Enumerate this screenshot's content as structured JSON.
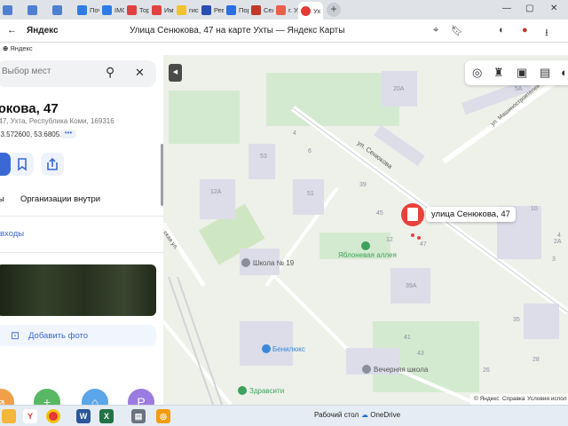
{
  "browser": {
    "tabs": [
      {
        "label": "",
        "color": "#4f7fd1"
      },
      {
        "label": "",
        "color": "#4f7fd1"
      },
      {
        "label": "",
        "color": "#4f7fd1"
      },
      {
        "label": "Поч",
        "color": "#2e7be6"
      },
      {
        "label": "IMC",
        "color": "#2e7be6"
      },
      {
        "label": "Тор",
        "color": "#e24141"
      },
      {
        "label": "Иму",
        "color": "#e24141"
      },
      {
        "label": "гис",
        "color": "#f2c230"
      },
      {
        "label": "Рев",
        "color": "#2a4db0"
      },
      {
        "label": "Пор",
        "color": "#2a6fe0"
      },
      {
        "label": "Сел",
        "color": "#c0392b"
      },
      {
        "label": "г. Ух",
        "color": "#e8604c"
      },
      {
        "label": "Ух",
        "color": "#e53935"
      }
    ],
    "new_tab": "+",
    "brand": "Яндекс",
    "page_title": "Улица Сенюкова, 47 на карте Ухты — Яндекс Карты",
    "bookmark": "Яндекс"
  },
  "panel": {
    "search_placeholder": "Выбор мест",
    "address_title": "юкова, 47",
    "address_sub": ", 47, Ухта, Республика Коми, 169316",
    "coordinates": "63.572600, 53.680510",
    "coords_more": "•••",
    "tab_1": "ы",
    "tab_2": "Организации внутри",
    "link": "входы",
    "add_photo": "Добавить фото"
  },
  "map": {
    "streets": {
      "senyukova": "ул. Сенюкова",
      "mashinostroiteley": "ул. Машиностроителей",
      "side": "ская ул."
    },
    "places": {
      "school19": "Школа № 19",
      "yablonevaya": "Яблоневая аллея",
      "benilux": "Бенилюкс",
      "evening_school": "Вечерняя школа",
      "zdravsiti": "Здравсити"
    },
    "building_numbers": [
      "20А",
      "53",
      "12А",
      "51",
      "45",
      "39",
      "12",
      "47",
      "39А",
      "35",
      "43",
      "26",
      "28",
      "10",
      "5А",
      "3",
      "4",
      "2А",
      "41",
      "4",
      "6"
    ],
    "marker_label": "улица Сенюкова, 47",
    "copyright": {
      "yandex": "© Яндекс",
      "help": "Справка",
      "terms": "Условия испол"
    }
  },
  "taskbar": {
    "desktop_label": "Рабочий стол",
    "onedrive": "OneDrive"
  },
  "colors": {
    "accent": "#3a69d6",
    "marker": "#e8403a",
    "park": "#cfe6c3",
    "building": "#dcdde8",
    "road": "#ffffff"
  }
}
